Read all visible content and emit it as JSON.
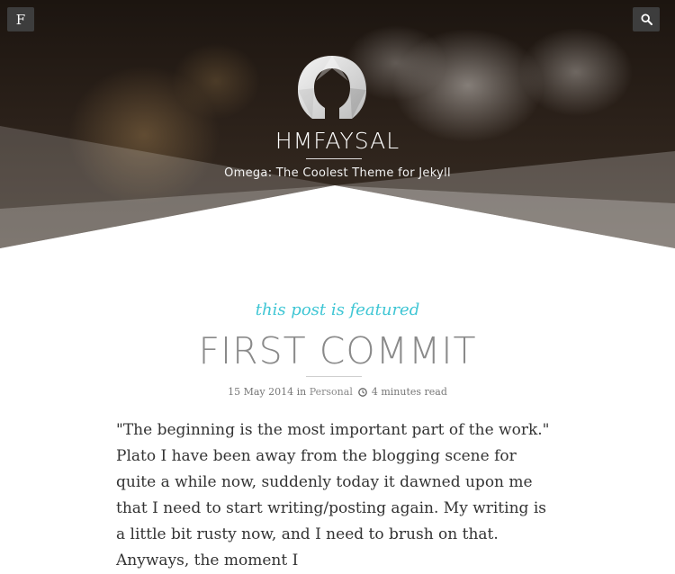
{
  "header": {
    "menu_button_label": "F",
    "site_title": "HMFAYSAL",
    "tagline": "Omega: The Coolest Theme for Jekyll",
    "logo_icon": "omega-logo-icon",
    "search_icon": "search-icon"
  },
  "post": {
    "featured_label": "this post is featured",
    "title": "FIRST COMMIT",
    "date": "15 May 2014",
    "in_text": "in",
    "category": "Personal",
    "clock_icon": "clock-icon",
    "read_time": "4 minutes read",
    "body": "\"The beginning is the most important part of the work.\" Plato I have been away from the blogging scene for quite a while now, suddenly today it dawned upon me that I need to start writing/posting again. My writing is a little bit rusty now, and I need to brush on that. Anyways, the moment I"
  },
  "colors": {
    "accent": "#3fc6d4",
    "title_gray": "#8a8a8a",
    "text": "#333333"
  }
}
